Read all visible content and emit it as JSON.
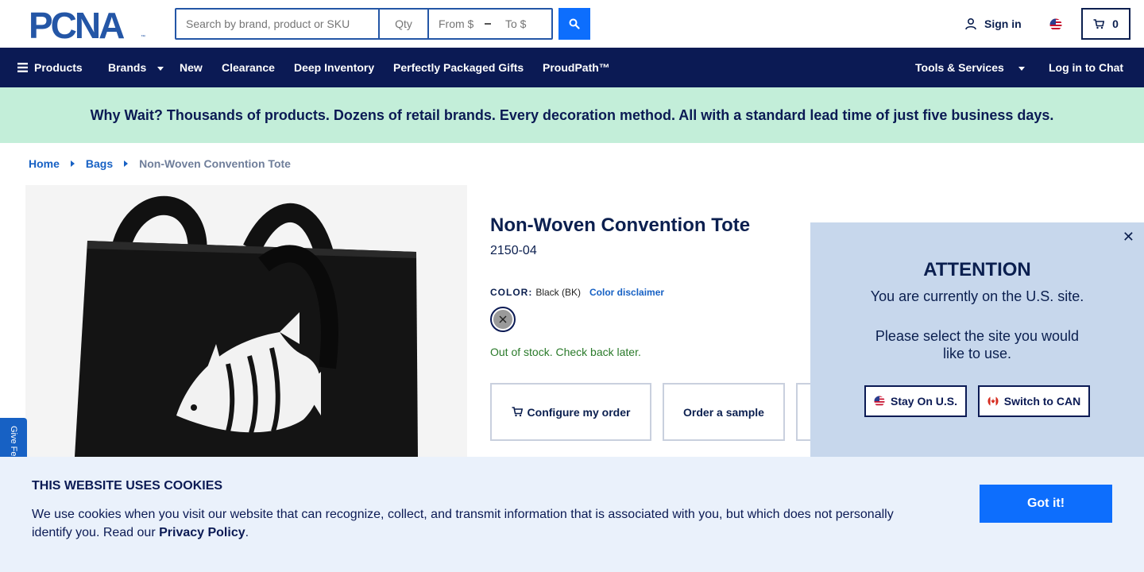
{
  "header": {
    "logo_text": "PCNA",
    "search_placeholder": "Search by brand, product or SKU",
    "qty_placeholder": "Qty",
    "from_placeholder": "From $",
    "to_placeholder": "To $",
    "sign_in_label": "Sign in",
    "cart_count": "0"
  },
  "nav": {
    "products": "Products",
    "brands": "Brands",
    "new": "New",
    "clearance": "Clearance",
    "deep_inventory": "Deep Inventory",
    "gifts": "Perfectly Packaged Gifts",
    "proudpath": "ProudPath™",
    "tools": "Tools & Services",
    "chat": "Log in to Chat"
  },
  "promo": {
    "text": "Why Wait? Thousands of products. Dozens of retail brands. Every decoration method. All with a standard lead time of just five business days."
  },
  "breadcrumb": {
    "home": "Home",
    "bags": "Bags",
    "current": "Non-Woven Convention Tote"
  },
  "product": {
    "title": "Non-Woven Convention Tote",
    "sku": "2150-04",
    "color_label": "COLOR:",
    "color_value": "Black (BK)",
    "color_disclaimer": "Color disclaimer",
    "stock_text": "Out of stock. Check back later.",
    "configure_label": "Configure my order",
    "sample_label": "Order a sample"
  },
  "attention": {
    "title": "ATTENTION",
    "line1": "You are currently on the U.S. site.",
    "line2": "Please select the site you would like to use.",
    "stay_label": "Stay On U.S.",
    "switch_label": "Switch to CAN"
  },
  "feedback": {
    "label": "Give Feedback"
  },
  "cookie": {
    "title": "THIS WEBSITE USES COOKIES",
    "text_before": "We use cookies when you visit our website that can recognize, collect, and transmit information that is associated with you, but which does not personally identify you. Read our ",
    "privacy_link": "Privacy Policy",
    "text_after": ".",
    "button_label": "Got it!"
  },
  "colors": {
    "navy": "#0b1a54",
    "brand_blue": "#2456a6",
    "button_blue": "#0d6efd",
    "promo_bg": "#c3eed9",
    "modal_bg": "#c7d7ec",
    "cookie_bg": "#eaf1fb",
    "stock_green": "#2a7a2a"
  }
}
